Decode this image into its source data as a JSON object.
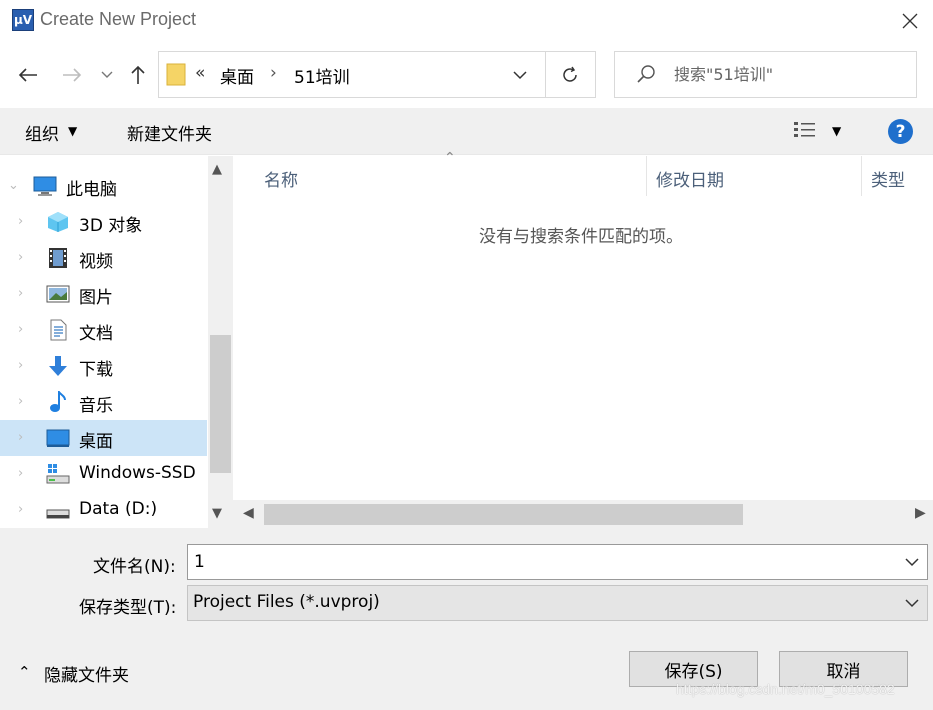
{
  "window": {
    "title": "Create New Project",
    "app_icon_text": "µV"
  },
  "address": {
    "overflow": "«",
    "crumbs": [
      "桌面",
      "51培训"
    ],
    "separator": "›"
  },
  "search": {
    "placeholder": "搜索\"51培训\""
  },
  "toolbar": {
    "organize": "组织",
    "new_folder": "新建文件夹",
    "help": "?"
  },
  "nav_pane": {
    "items": [
      {
        "label": "此电脑",
        "icon": "computer-icon"
      },
      {
        "label": "3D 对象",
        "icon": "cube-icon"
      },
      {
        "label": "视频",
        "icon": "video-icon"
      },
      {
        "label": "图片",
        "icon": "picture-icon"
      },
      {
        "label": "文档",
        "icon": "document-icon"
      },
      {
        "label": "下载",
        "icon": "download-icon"
      },
      {
        "label": "音乐",
        "icon": "music-icon"
      },
      {
        "label": "桌面",
        "icon": "desktop-icon"
      },
      {
        "label": "Windows-SSD",
        "icon": "drive-icon"
      },
      {
        "label": "Data (D:)",
        "icon": "drive-icon"
      }
    ]
  },
  "content": {
    "columns": [
      "名称",
      "修改日期",
      "类型"
    ],
    "empty_message": "没有与搜索条件匹配的项。"
  },
  "form": {
    "filename_label": "文件名(N):",
    "filename_value": "1",
    "filetype_label": "保存类型(T):",
    "filetype_value": "Project Files (*.uvproj)"
  },
  "footer": {
    "hide_folders": "隐藏文件夹",
    "save": "保存(S)",
    "cancel": "取消",
    "watermark": "https://blog.csdn.net/m0_50100582"
  },
  "colors": {
    "accent": "#1f6fcc",
    "selection": "#cce4f7",
    "panel": "#f0f0f0"
  }
}
